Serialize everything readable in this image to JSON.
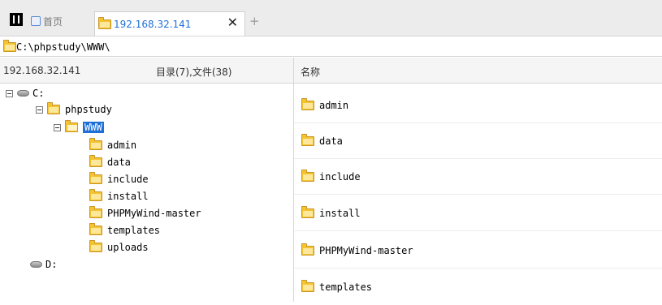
{
  "tabs": {
    "home_label": "首页",
    "active_label": "192.168.32.141",
    "close_glyph": "✕",
    "add_glyph": "+"
  },
  "path": {
    "value": "C:\\phpstudy\\WWW\\"
  },
  "header": {
    "host": "192.168.32.141",
    "counts": "目录(7),文件(38)",
    "name_column": "名称"
  },
  "tree": {
    "drive_c": "C:",
    "phpstudy": "phpstudy",
    "www": "WWW",
    "children": [
      "admin",
      "data",
      "include",
      "install",
      "PHPMyWind-master",
      "templates",
      "uploads"
    ],
    "drive_d": "D:"
  },
  "list": {
    "items": [
      "admin",
      "data",
      "include",
      "install",
      "PHPMyWind-master",
      "templates"
    ]
  },
  "colors": {
    "accent": "#1e6fd8",
    "folder": "#f4c430"
  }
}
